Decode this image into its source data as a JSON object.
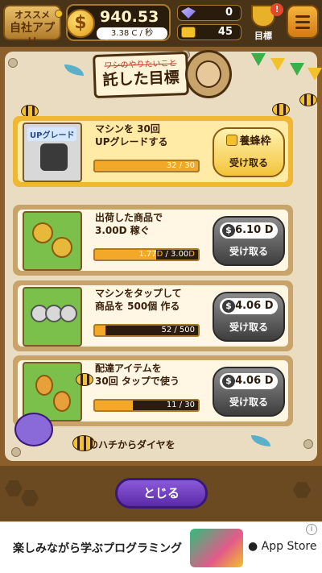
{
  "header": {
    "app_badge_line1": "オススメ",
    "app_badge_line2": "自社アプリ",
    "money_amount": "940.53",
    "money_unit": "C",
    "money_rate": "3.38 C / 秒",
    "diamonds": "0",
    "honeycombs": "45",
    "goal_label": "目標",
    "alert_mark": "!",
    "coin_symbol": "$"
  },
  "title": {
    "strike_text": "ワシのやりたいこと",
    "main_text": "託した目標"
  },
  "missions": [
    {
      "thumb_tag": "UPグレード",
      "desc_line1": "マシンを 30回",
      "desc_line2": "UPグレードする",
      "progress_text": "32 / 30",
      "progress_fraction": 1.0,
      "reward": "養蜂枠",
      "claim_label": "受け取る"
    },
    {
      "desc_line1": "出荷した商品で",
      "desc_line2": "3.00D 稼ぐ",
      "progress_current": "1.77",
      "progress_unit_cur": "D",
      "progress_sep": " / ",
      "progress_total": "3.00",
      "progress_unit_total": "D",
      "progress_fraction": 0.59,
      "reward": "6.10",
      "reward_unit": "D",
      "claim_label": "受け取る"
    },
    {
      "desc_line1": "マシンをタップして",
      "desc_line2": "商品を 500個 作る",
      "progress_text": "52 / 500",
      "progress_fraction": 0.104,
      "reward": "4.06",
      "reward_unit": "D",
      "claim_label": "受け取る"
    },
    {
      "desc_line1": "配達アイテムを",
      "desc_line2": "30回 タップで使う",
      "progress_text": "11 / 30",
      "progress_fraction": 0.367,
      "reward": "4.06",
      "reward_unit": "D",
      "claim_label": "受け取る"
    }
  ],
  "teaser": "のハチからダイヤを",
  "close_label": "とじる",
  "ad": {
    "text": "楽しみながら学ぶプログラミング",
    "store": " App Store",
    "info": "i"
  },
  "colors": {
    "accent_gold": "#f0b730",
    "progress_fill": "#f3a82a",
    "close_purple": "#6a3ac0"
  }
}
